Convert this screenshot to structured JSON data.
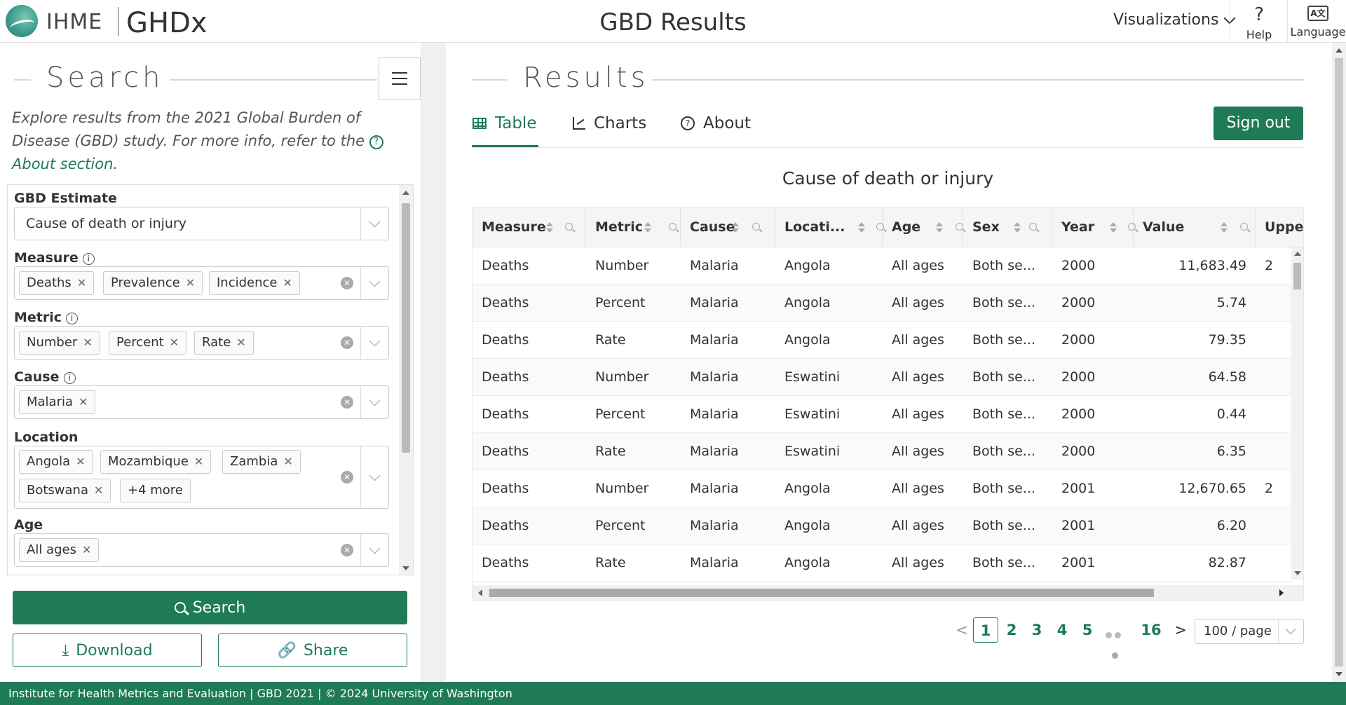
{
  "header": {
    "org": "IHME",
    "product": "GHDx",
    "title": "GBD Results",
    "visualizations": "Visualizations",
    "help": "Help",
    "language": "Language",
    "help_glyph": "?",
    "language_glyph": "A文"
  },
  "search_panel": {
    "title": "Search",
    "intro": "Explore results from the 2021 Global Burden of Disease (GBD) study. For more info, refer to the",
    "about_link": "About section.",
    "filters": {
      "estimate": {
        "label": "GBD Estimate",
        "value": "Cause of death or injury"
      },
      "measure": {
        "label": "Measure",
        "tags": [
          "Deaths",
          "Prevalence",
          "Incidence"
        ]
      },
      "metric": {
        "label": "Metric",
        "tags": [
          "Number",
          "Percent",
          "Rate"
        ]
      },
      "cause": {
        "label": "Cause",
        "tags": [
          "Malaria"
        ]
      },
      "location": {
        "label": "Location",
        "tags": [
          "Angola",
          "Mozambique",
          "Zambia",
          "Botswana"
        ],
        "more": "+4 more"
      },
      "age": {
        "label": "Age",
        "tags": [
          "All ages"
        ]
      }
    },
    "search_button": "Search",
    "download_button": "Download",
    "share_button": "Share"
  },
  "results": {
    "title": "Results",
    "tabs": [
      "Table",
      "Charts",
      "About"
    ],
    "active_tab": "Table",
    "signout": "Sign out",
    "table_title": "Cause of death or injury",
    "columns": [
      "Measure",
      "Metric",
      "Cause",
      "Locati...",
      "Age",
      "Sex",
      "Year",
      "Value",
      "Uppe"
    ],
    "rows": [
      [
        "Deaths",
        "Number",
        "Malaria",
        "Angola",
        "All ages",
        "Both se...",
        "2000",
        "11,683.49",
        "2"
      ],
      [
        "Deaths",
        "Percent",
        "Malaria",
        "Angola",
        "All ages",
        "Both se...",
        "2000",
        "5.74",
        ""
      ],
      [
        "Deaths",
        "Rate",
        "Malaria",
        "Angola",
        "All ages",
        "Both se...",
        "2000",
        "79.35",
        ""
      ],
      [
        "Deaths",
        "Number",
        "Malaria",
        "Eswatini",
        "All ages",
        "Both se...",
        "2000",
        "64.58",
        ""
      ],
      [
        "Deaths",
        "Percent",
        "Malaria",
        "Eswatini",
        "All ages",
        "Both se...",
        "2000",
        "0.44",
        ""
      ],
      [
        "Deaths",
        "Rate",
        "Malaria",
        "Eswatini",
        "All ages",
        "Both se...",
        "2000",
        "6.35",
        ""
      ],
      [
        "Deaths",
        "Number",
        "Malaria",
        "Angola",
        "All ages",
        "Both se...",
        "2001",
        "12,670.65",
        "2"
      ],
      [
        "Deaths",
        "Percent",
        "Malaria",
        "Angola",
        "All ages",
        "Both se...",
        "2001",
        "6.20",
        ""
      ],
      [
        "Deaths",
        "Rate",
        "Malaria",
        "Angola",
        "All ages",
        "Both se...",
        "2001",
        "82.87",
        ""
      ]
    ],
    "pagination": {
      "prev": "<",
      "pages": [
        "1",
        "2",
        "3",
        "4",
        "5"
      ],
      "last": "16",
      "next": ">",
      "current": "1",
      "page_size": "100 / page"
    }
  },
  "footer": {
    "text": "Institute for Health Metrics and Evaluation   |   GBD 2021   |   © 2024 University of Washington"
  },
  "colors": {
    "brand_green": "#1e7b55"
  }
}
